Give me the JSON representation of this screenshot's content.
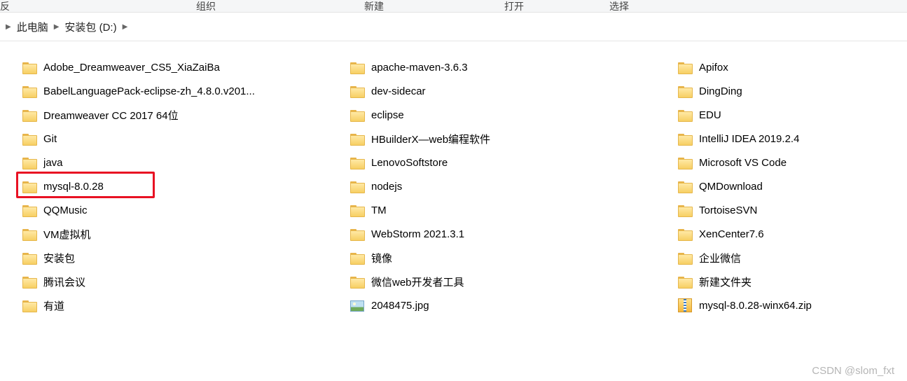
{
  "toolbar": {
    "labels": [
      "反",
      "组织",
      "新建",
      "打开",
      "选择"
    ],
    "positions": [
      0,
      280,
      520,
      720,
      870
    ]
  },
  "breadcrumb": [
    {
      "label": "此电脑"
    },
    {
      "label": "安装包 (D:)"
    }
  ],
  "columns": [
    [
      {
        "type": "folder",
        "name": "Adobe_Dreamweaver_CS5_XiaZaiBa"
      },
      {
        "type": "folder",
        "name": "BabelLanguagePack-eclipse-zh_4.8.0.v201..."
      },
      {
        "type": "folder",
        "name": "Dreamweaver CC 2017 64位"
      },
      {
        "type": "folder",
        "name": "Git"
      },
      {
        "type": "folder",
        "name": "java"
      },
      {
        "type": "folder",
        "name": "mysql-8.0.28",
        "highlighted": true
      },
      {
        "type": "folder",
        "name": "QQMusic"
      },
      {
        "type": "folder",
        "name": "VM虚拟机"
      },
      {
        "type": "folder",
        "name": "安装包"
      },
      {
        "type": "folder",
        "name": "腾讯会议"
      },
      {
        "type": "folder",
        "name": "有道"
      }
    ],
    [
      {
        "type": "folder",
        "name": "apache-maven-3.6.3"
      },
      {
        "type": "folder",
        "name": "dev-sidecar"
      },
      {
        "type": "folder",
        "name": "eclipse"
      },
      {
        "type": "folder",
        "name": "HBuilderX—web编程软件"
      },
      {
        "type": "folder",
        "name": "LenovoSoftstore"
      },
      {
        "type": "folder",
        "name": "nodejs"
      },
      {
        "type": "folder",
        "name": "TM"
      },
      {
        "type": "folder",
        "name": "WebStorm 2021.3.1"
      },
      {
        "type": "folder",
        "name": "镜像"
      },
      {
        "type": "folder",
        "name": "微信web开发者工具"
      },
      {
        "type": "image",
        "name": "2048475.jpg"
      }
    ],
    [
      {
        "type": "folder",
        "name": "Apifox"
      },
      {
        "type": "folder",
        "name": "DingDing"
      },
      {
        "type": "folder",
        "name": "EDU"
      },
      {
        "type": "folder",
        "name": "IntelliJ IDEA 2019.2.4"
      },
      {
        "type": "folder",
        "name": "Microsoft VS Code"
      },
      {
        "type": "folder",
        "name": "QMDownload"
      },
      {
        "type": "folder",
        "name": "TortoiseSVN"
      },
      {
        "type": "folder",
        "name": "XenCenter7.6"
      },
      {
        "type": "folder",
        "name": "企业微信"
      },
      {
        "type": "folder",
        "name": "新建文件夹"
      },
      {
        "type": "zip",
        "name": "mysql-8.0.28-winx64.zip"
      }
    ]
  ],
  "watermark": "CSDN @slom_fxt"
}
